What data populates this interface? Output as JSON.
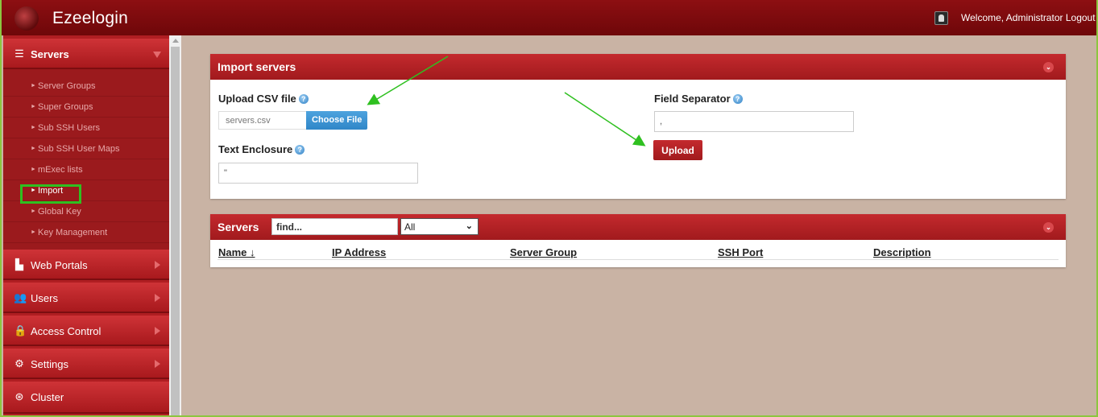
{
  "app": {
    "name": "Ezeelogin",
    "welcome": "Welcome, Administrator",
    "logout": "Logout"
  },
  "sidebar": {
    "servers": {
      "label": "Servers",
      "icon": "list-icon"
    },
    "sub_items": [
      "Server Groups",
      "Super Groups",
      "Sub SSH Users",
      "Sub SSH User Maps",
      "mExec lists",
      "Import",
      "Global Key",
      "Key Management"
    ],
    "active_item": "Import",
    "main_items": [
      {
        "label": "Web Portals",
        "icon": "dashboard-icon"
      },
      {
        "label": "Users",
        "icon": "users-icon"
      },
      {
        "label": "Access Control",
        "icon": "lock-icon"
      },
      {
        "label": "Settings",
        "icon": "gears-icon"
      },
      {
        "label": "Cluster",
        "icon": "cluster-icon"
      }
    ]
  },
  "import_panel": {
    "title": "Import servers",
    "upload_label": "Upload CSV file",
    "file_name": "servers.csv",
    "choose_file": "Choose File",
    "text_enclosure_label": "Text Enclosure",
    "text_enclosure_value": "\"",
    "field_separator_label": "Field Separator",
    "field_separator_value": ",",
    "upload_button": "Upload"
  },
  "servers_panel": {
    "title": "Servers",
    "search_placeholder": "find...",
    "filter_value": "All",
    "columns": [
      "Name ↓",
      "IP Address",
      "Server Group",
      "SSH Port",
      "Description"
    ]
  },
  "colors": {
    "brand_red": "#b01e22",
    "accent_blue": "#2f86c8",
    "annotation_green": "#2fc020"
  }
}
